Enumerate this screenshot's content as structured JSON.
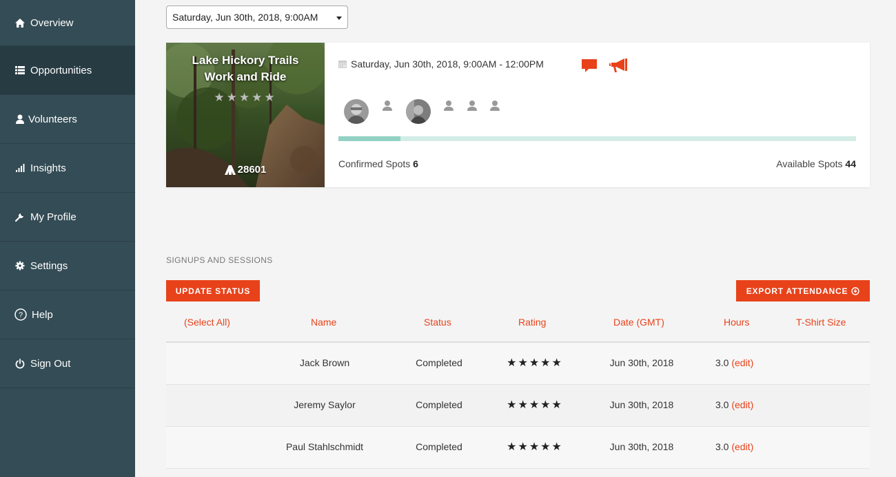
{
  "sidebar": {
    "items": [
      {
        "label": "Overview",
        "icon": "home-icon"
      },
      {
        "label": "Opportunities",
        "icon": "list-icon"
      },
      {
        "label": "Volunteers",
        "icon": "user-icon"
      },
      {
        "label": "Insights",
        "icon": "bar-chart-icon"
      },
      {
        "label": "My Profile",
        "icon": "wrench-icon"
      },
      {
        "label": "Settings",
        "icon": "gear-icon"
      },
      {
        "label": "Help",
        "icon": "question-icon"
      },
      {
        "label": "Sign Out",
        "icon": "power-icon"
      }
    ],
    "active_index": 1
  },
  "session_select": {
    "value": "Saturday, Jun 30th, 2018, 9:00AM"
  },
  "opportunity": {
    "title_line1": "Lake Hickory Trails",
    "title_line2": "Work and Ride",
    "stars": "★★★★★",
    "zip": "28601",
    "date_range": "Saturday, Jun 30th, 2018, 9:00AM - 12:00PM",
    "confirmed_label": "Confirmed Spots",
    "confirmed_value": "6",
    "available_label": "Available Spots",
    "available_value": "44",
    "progress_fraction": 0.12
  },
  "section": {
    "title": "SIGNUPS AND SESSIONS"
  },
  "buttons": {
    "update_status": "UPDATE STATUS",
    "export_attendance": "EXPORT ATTENDANCE"
  },
  "table": {
    "headers": [
      "(Select All)",
      "Name",
      "Status",
      "Rating",
      "Date (GMT)",
      "Hours",
      "T-Shirt Size"
    ],
    "rows": [
      {
        "name": "Jack Brown",
        "status": "Completed",
        "rating": "★★★★★",
        "date": "Jun 30th, 2018",
        "hours": "3.0",
        "edit": "(edit)"
      },
      {
        "name": "Jeremy Saylor",
        "status": "Completed",
        "rating": "★★★★★",
        "date": "Jun 30th, 2018",
        "hours": "3.0",
        "edit": "(edit)"
      },
      {
        "name": "Paul Stahlschmidt",
        "status": "Completed",
        "rating": "★★★★★",
        "date": "Jun 30th, 2018",
        "hours": "3.0",
        "edit": "(edit)"
      }
    ]
  },
  "colors": {
    "accent": "#e8421a",
    "sidebar": "#344c55",
    "progress": "#92d1c3"
  }
}
